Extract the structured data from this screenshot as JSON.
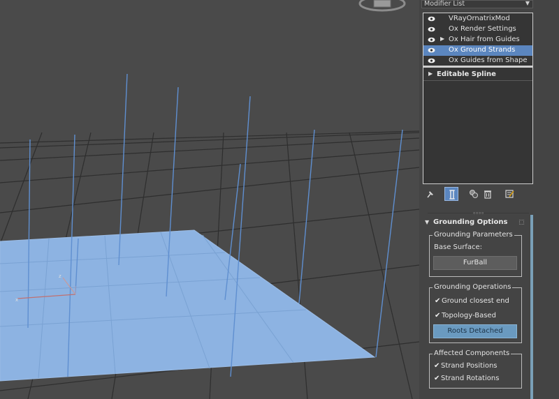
{
  "modifier_list": {
    "label": "Modifier List",
    "arrow_icon": "dropdown-arrow-icon"
  },
  "stack": {
    "items": [
      {
        "label": "VRayOrnatrixMod",
        "visible": true,
        "selected": false,
        "has_expander": false
      },
      {
        "label": "Ox Render Settings",
        "visible": true,
        "selected": false,
        "has_expander": false
      },
      {
        "label": "Ox Hair from Guides",
        "visible": true,
        "selected": false,
        "has_expander": true
      },
      {
        "label": "Ox Ground Strands",
        "visible": true,
        "selected": true,
        "has_expander": false
      },
      {
        "label": "Ox Guides from Shape",
        "visible": true,
        "selected": false,
        "has_expander": false
      }
    ],
    "base_object": "Editable Spline"
  },
  "toolbar": {
    "buttons": [
      "pin-stack-icon",
      "show-end-result-icon",
      "make-unique-icon",
      "remove-modifier-icon",
      "configure-modifier-sets-icon"
    ],
    "active": "show-end-result-icon"
  },
  "rollout": {
    "title": "Grounding Options",
    "grounding_parameters": {
      "title": "Grounding Parameters",
      "base_surface_label": "Base Surface:",
      "base_surface_value": "FurBall"
    },
    "grounding_operations": {
      "title": "Grounding Operations",
      "ground_closest_end": {
        "label": "Ground closest end",
        "checked": true
      },
      "topology_based": {
        "label": "Topology-Based",
        "checked": true
      },
      "roots_detached_label": "Roots Detached"
    },
    "affected_components": {
      "title": "Affected Components",
      "strand_positions": {
        "label": "Strand Positions",
        "checked": true
      },
      "strand_rotations": {
        "label": "Strand Rotations",
        "checked": true
      }
    }
  },
  "colors": {
    "viewport_bg": "#4a4a4a",
    "grid_line": "#2b2b2b",
    "ground_plane": "#8db3e2",
    "guide_strand": "#5f8fd0",
    "selection": "#5b86bf",
    "panel_bg": "#444444"
  }
}
